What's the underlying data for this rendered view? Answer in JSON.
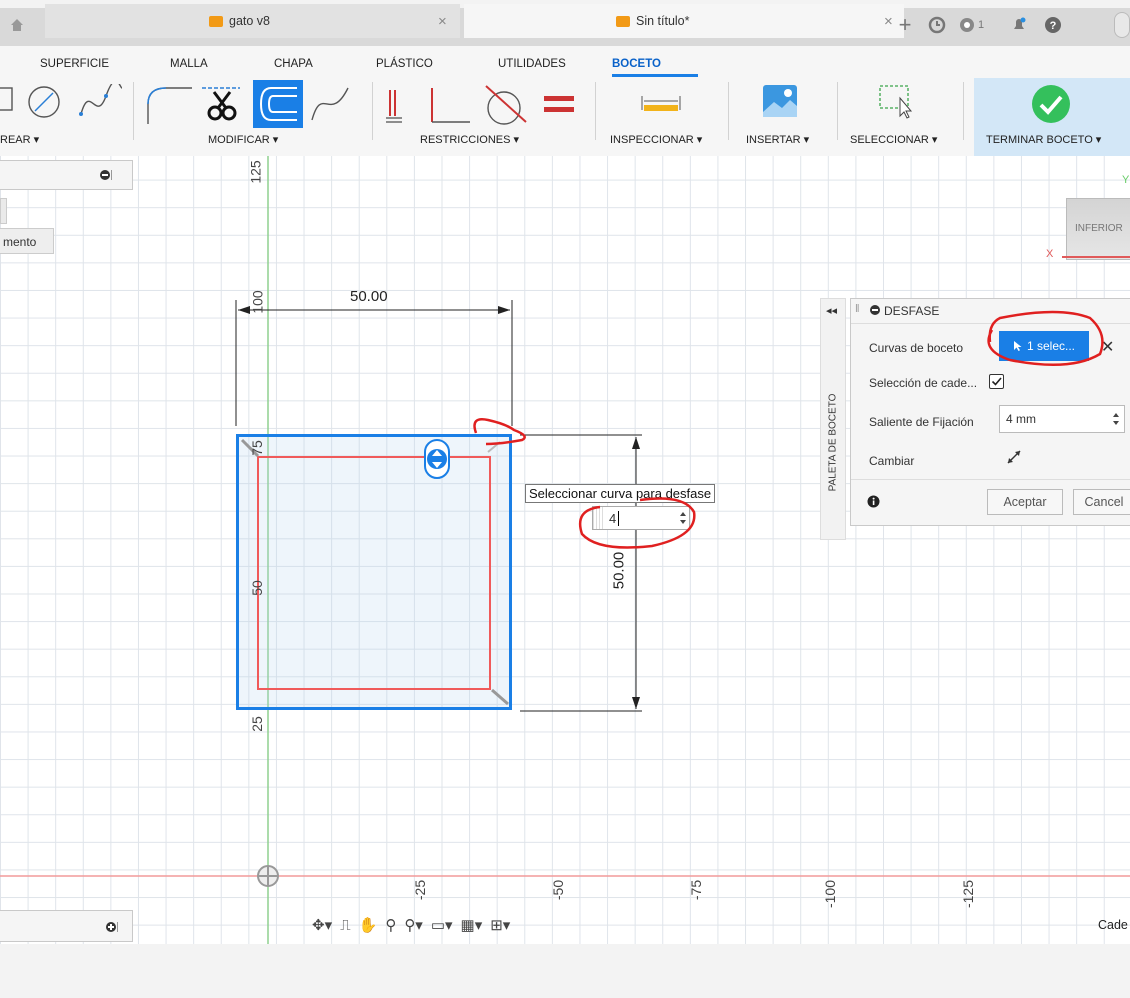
{
  "tabs": [
    {
      "title": "gato v8",
      "active": false
    },
    {
      "title": "Sin título*",
      "active": true
    }
  ],
  "top_icons": {
    "add": "+",
    "notifications_count": "1",
    "help": "?"
  },
  "ribbon_tabs": [
    "SUPERFICIE",
    "MALLA",
    "CHAPA",
    "PLÁSTICO",
    "UTILIDADES",
    "BOCETO"
  ],
  "active_ribbon_tab": "BOCETO",
  "groups": {
    "crear": "REAR ▾",
    "modificar": "MODIFICAR ▾",
    "restricciones": "RESTRICCIONES ▾",
    "inspeccionar": "INSPECCIONAR ▾",
    "insertar": "INSERTAR ▾",
    "seleccionar": "SELECCIONAR ▾",
    "terminar": "TERMINAR BOCETO ▾"
  },
  "browser": {
    "item_fragment": "mento"
  },
  "viewcube": {
    "face": "INFERIOR",
    "x_label": "X",
    "y_label": "Y"
  },
  "dimensions": {
    "horizontal": "50.00",
    "vertical": "50.00"
  },
  "vertical_ruler": [
    "125",
    "100",
    "75",
    "50",
    "25"
  ],
  "horizontal_ruler": [
    "-25",
    "-50",
    "-75",
    "-100",
    "-125"
  ],
  "tooltip": "Seleccionar curva para desfase",
  "offset_input_value": "4",
  "palette": {
    "title": "PALETA DE BOCETO"
  },
  "dialog": {
    "title": "DESFASE",
    "rows": [
      {
        "label": "Curvas de boceto",
        "value": "1 selec..."
      },
      {
        "label": "Selección de cade...",
        "checked": true
      },
      {
        "label": "Saliente de Fijación",
        "value": "4 mm"
      },
      {
        "label": "Cambiar"
      }
    ],
    "ok": "Aceptar",
    "cancel": "Cancel"
  },
  "bottom_right_label": "Cade",
  "colors": {
    "selection_blue": "#1a7fe6",
    "offset_red": "#f05a5a",
    "annotation_red": "#e02020",
    "confirm_green": "#34c05c"
  }
}
